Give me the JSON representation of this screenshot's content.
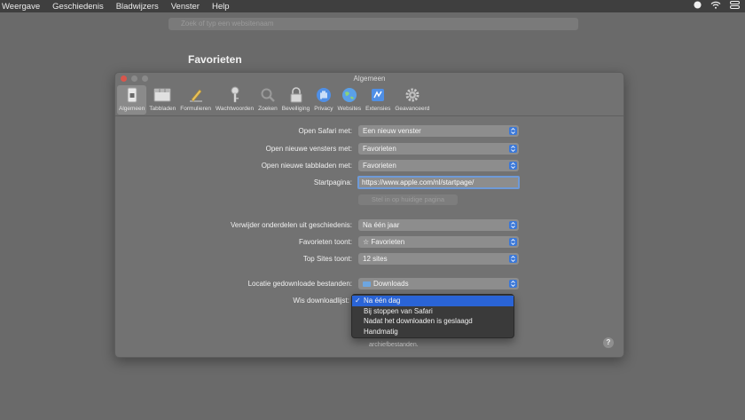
{
  "menubar": {
    "items": [
      "Weergave",
      "Geschiedenis",
      "Bladwijzers",
      "Venster",
      "Help"
    ]
  },
  "address_bar": {
    "placeholder": "Zoek of typ een websitenaam"
  },
  "page": {
    "title": "Favorieten"
  },
  "prefs": {
    "window_title": "Algemeen",
    "toolbar": [
      {
        "label": "Algemeen",
        "icon": "switch-icon"
      },
      {
        "label": "Tabbladen",
        "icon": "tabs-icon"
      },
      {
        "label": "Formulieren",
        "icon": "pencil-icon"
      },
      {
        "label": "Wachtwoorden",
        "icon": "key-icon"
      },
      {
        "label": "Zoeken",
        "icon": "magnifier-icon"
      },
      {
        "label": "Beveiliging",
        "icon": "lock-icon"
      },
      {
        "label": "Privacy",
        "icon": "hand-icon"
      },
      {
        "label": "Websites",
        "icon": "globe-icon"
      },
      {
        "label": "Extensies",
        "icon": "puzzle-icon"
      },
      {
        "label": "Geavanceerd",
        "icon": "gear-icon"
      }
    ],
    "rows": {
      "open_safari": {
        "label": "Open Safari met:",
        "value": "Een nieuw venster"
      },
      "new_windows": {
        "label": "Open nieuwe vensters met:",
        "value": "Favorieten"
      },
      "new_tabs": {
        "label": "Open nieuwe tabbladen met:",
        "value": "Favorieten"
      },
      "homepage": {
        "label": "Startpagina:",
        "value": "https://www.apple.com/nl/startpage/"
      },
      "set_current_button": "Stel in op huidige pagina",
      "remove_history": {
        "label": "Verwijder onderdelen uit geschiedenis:",
        "value": "Na één jaar"
      },
      "favorites_shows": {
        "label": "Favorieten toont:",
        "value": "☆ Favorieten"
      },
      "top_sites": {
        "label": "Top Sites toont:",
        "value": "12 sites"
      },
      "download_location": {
        "label": "Locatie gedownloade bestanden:",
        "value": "Downloads"
      },
      "clear_downloads": {
        "label": "Wis downloadlijst:"
      }
    },
    "dropdown_options": [
      {
        "label": "Na één dag",
        "selected": true
      },
      {
        "label": "Bij stoppen van Safari",
        "selected": false
      },
      {
        "label": "Nadat het downloaden is geslaagd",
        "selected": false
      },
      {
        "label": "Handmatig",
        "selected": false
      }
    ],
    "footnote": "archiefbestanden.",
    "help_label": "?"
  },
  "colors": {
    "accent": "#2a64d6",
    "popup_arrow": "#3b78d8"
  }
}
